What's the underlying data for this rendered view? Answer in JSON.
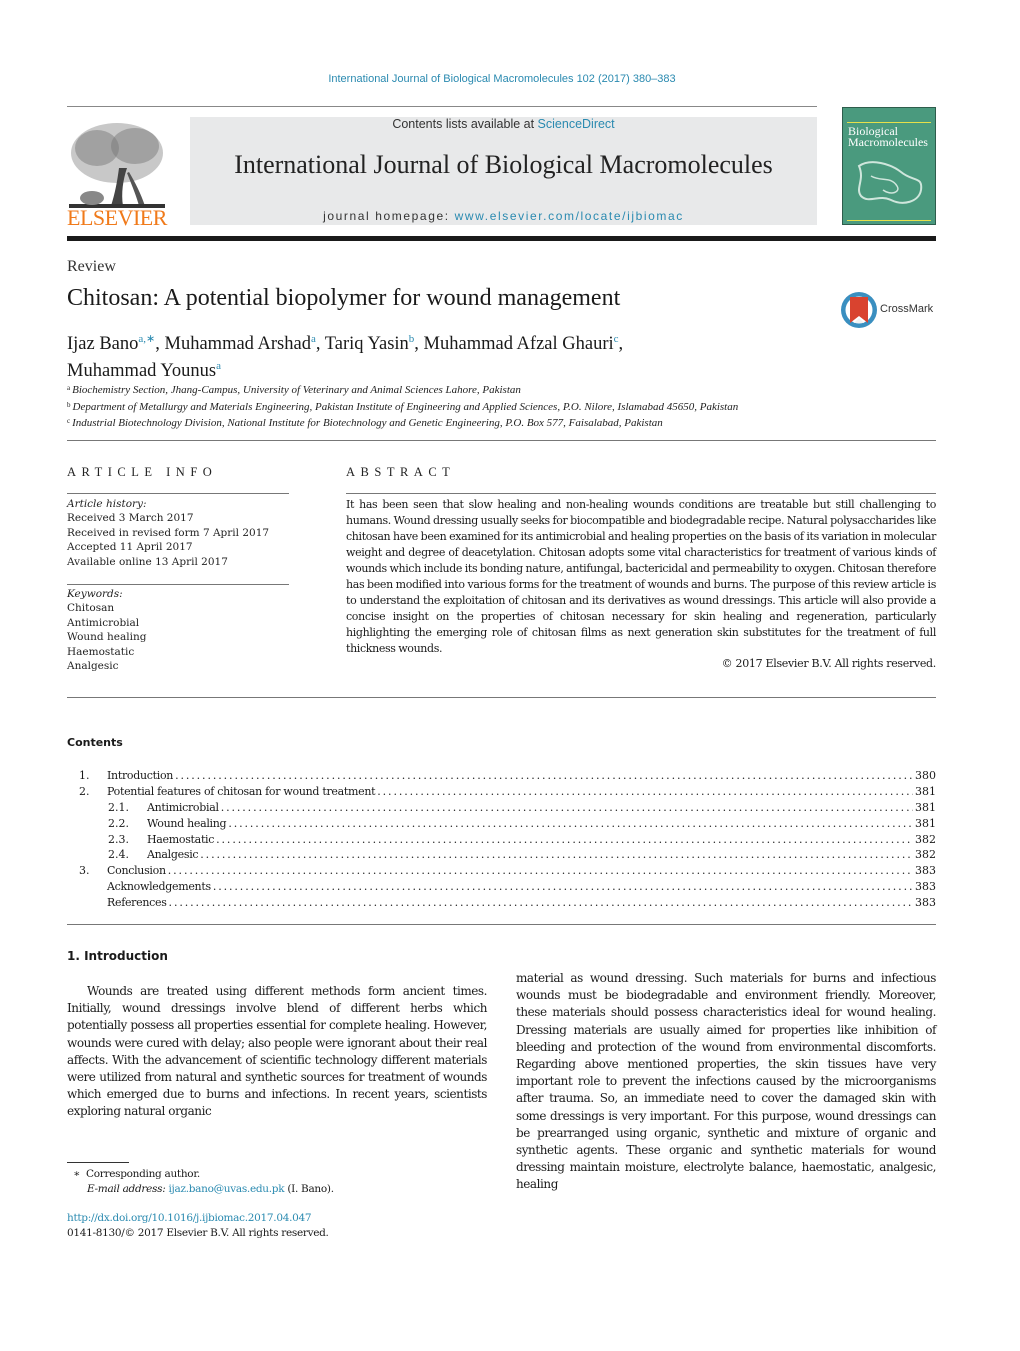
{
  "running_head": "International Journal of Biological Macromolecules 102 (2017) 380–383",
  "masthead": {
    "publisher_logo": "ELSEVIER",
    "contents_prefix": "Contents lists available at ",
    "contents_link": "ScienceDirect",
    "journal_title": "International Journal of Biological Macromolecules",
    "homepage_prefix": "journal homepage: ",
    "homepage_link": "www.elsevier.com/locate/ijbiomac",
    "cover_title_line1": "Biological",
    "cover_title_line2": "Macromolecules"
  },
  "article": {
    "type": "Review",
    "title": "Chitosan: A potential biopolymer for wound management",
    "authors": [
      {
        "name": "Ijaz Bano",
        "sup": "a,∗",
        "sep": ", "
      },
      {
        "name": "Muhammad Arshad",
        "sup": "a",
        "sep": ", "
      },
      {
        "name": "Tariq Yasin",
        "sup": "b",
        "sep": ", "
      },
      {
        "name": "Muhammad Afzal Ghauri",
        "sup": "c",
        "sep": ","
      },
      {
        "name": "Muhammad Younus",
        "sup": "a",
        "sep": ""
      }
    ],
    "crossmark_label": "CrossMark",
    "affiliations": [
      {
        "key": "a",
        "text": "Biochemistry Section, Jhang-Campus, University of Veterinary and Animal Sciences Lahore, Pakistan"
      },
      {
        "key": "b",
        "text": "Department of Metallurgy and Materials Engineering, Pakistan Institute of Engineering and Applied Sciences, P.O. Nilore, Islamabad 45650, Pakistan"
      },
      {
        "key": "c",
        "text": "Industrial Biotechnology Division, National Institute for Biotechnology and Genetic Engineering, P.O. Box 577, Faisalabad, Pakistan"
      }
    ]
  },
  "article_info": {
    "heading": "ARTICLE INFO",
    "history_label": "Article history:",
    "history": [
      "Received 3 March 2017",
      "Received in revised form 7 April 2017",
      "Accepted 11 April 2017",
      "Available online 13 April 2017"
    ],
    "keywords_label": "Keywords:",
    "keywords": [
      "Chitosan",
      "Antimicrobial",
      "Wound healing",
      "Haemostatic",
      "Analgesic"
    ]
  },
  "abstract": {
    "heading": "ABSTRACT",
    "text": "It has been seen that slow healing and non-healing wounds conditions are treatable but still challenging to humans. Wound dressing usually seeks for biocompatible and biodegradable recipe. Natural polysaccharides like chitosan have been examined for its antimicrobial and healing properties on the basis of its variation in molecular weight and degree of deacetylation. Chitosan adopts some vital characteristics for treatment of various kinds of wounds which include its bonding nature, antifungal, bactericidal and permeability to oxygen. Chitosan therefore has been modified into various forms for the treatment of wounds and burns. The purpose of this review article is to understand the exploitation of chitosan and its derivatives as wound dressings. This article will also provide a concise insight on the properties of chitosan necessary for skin healing and regeneration, particularly highlighting the emerging role of chitosan films as next generation skin substitutes for the treatment of full thickness wounds.",
    "copyright": "© 2017 Elsevier B.V. All rights reserved."
  },
  "contents": {
    "heading": "Contents",
    "items": [
      {
        "num": "1.",
        "label": "Introduction",
        "page": "380",
        "level": 1
      },
      {
        "num": "2.",
        "label": "Potential features of chitosan for wound treatment",
        "page": "381",
        "level": 1
      },
      {
        "num": "2.1.",
        "label": "Antimicrobial",
        "page": "381",
        "level": 2
      },
      {
        "num": "2.2.",
        "label": "Wound healing",
        "page": "381",
        "level": 2
      },
      {
        "num": "2.3.",
        "label": "Haemostatic",
        "page": "382",
        "level": 2
      },
      {
        "num": "2.4.",
        "label": "Analgesic",
        "page": "382",
        "level": 2
      },
      {
        "num": "3.",
        "label": "Conclusion",
        "page": "383",
        "level": 1
      },
      {
        "num": "",
        "label": "Acknowledgements",
        "page": "383",
        "level": 1
      },
      {
        "num": "",
        "label": "References",
        "page": "383",
        "level": 1
      }
    ]
  },
  "introduction": {
    "heading": "1.  Introduction",
    "left_column": "Wounds are treated using different methods form ancient times. Initially, wound dressings involve blend of different herbs which potentially possess all properties essential for complete healing. However, wounds were cured with delay; also people were ignorant about their real affects. With the advancement of scientific technology different materials were utilized from natural and synthetic sources for treatment of wounds which emerged due to burns and infections. In recent years, scientists exploring natural organic",
    "right_column": "material as wound dressing. Such materials for burns and infectious wounds must be biodegradable and environment friendly. Moreover, these materials should possess characteristics ideal for wound healing. Dressing materials are usually aimed for properties like inhibition of bleeding and protection of the wound from environmental discomforts. Regarding above mentioned properties, the skin tissues have very important role to prevent the infections caused by the microorganisms after trauma. So, an immediate need to cover the damaged skin with some dressings is very important. For this purpose, wound dressings can be prearranged using organic, synthetic and mixture of organic and synthetic agents. These organic and synthetic materials for wound dressing maintain moisture, electrolyte balance, haemostatic, analgesic, healing"
  },
  "footnotes": {
    "star": "∗",
    "corresponding": "Corresponding author.",
    "email_label": "E-mail address:",
    "email": "ijaz.bano@uvas.edu.pk",
    "email_suffix": " (I. Bano).",
    "doi": "http://dx.doi.org/10.1016/j.ijbiomac.2017.04.047",
    "issn_line": "0141-8130/© 2017 Elsevier B.V. All rights reserved."
  },
  "colors": {
    "link": "#2a8ab0",
    "elsevier_orange": "#f07a1a",
    "masthead_gray": "#e8e9ea",
    "cover_green": "#4a9a7e"
  }
}
